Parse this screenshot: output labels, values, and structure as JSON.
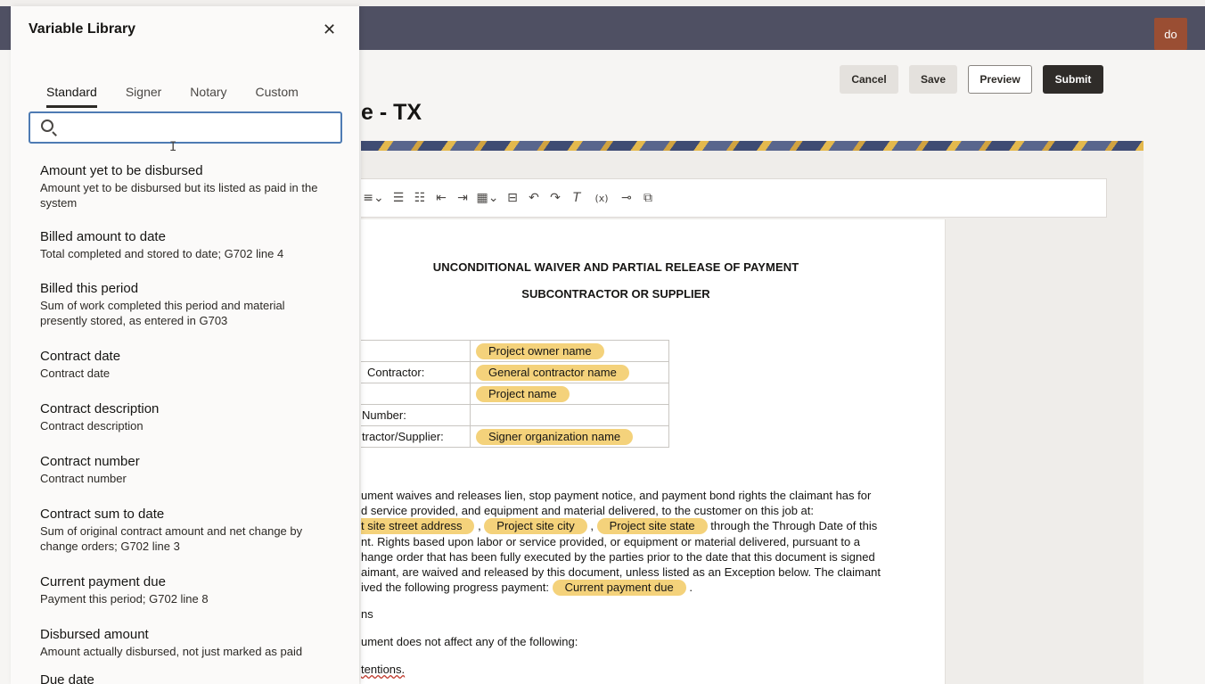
{
  "header": {
    "avatar_initials": "do"
  },
  "actions": {
    "cancel": "Cancel",
    "save": "Save",
    "preview": "Preview",
    "submit": "Submit"
  },
  "page": {
    "title_fragment": "e - TX"
  },
  "toolbar_icons": [
    "align-icon",
    "list-bulleted-icon",
    "list-numbered-icon",
    "outdent-icon",
    "indent-icon",
    "table-icon",
    "page-break-icon",
    "undo-icon",
    "redo-icon",
    "clear-format-icon",
    "variable-icon",
    "signature-icon",
    "copy-icon"
  ],
  "document": {
    "title": "UNCONDITIONAL WAIVER AND PARTIAL RELEASE OF PAYMENT",
    "subtitle": "SUBCONTRACTOR OR SUPPLIER",
    "info_rows": [
      {
        "label": "",
        "value": "Project owner name"
      },
      {
        "label": "Contractor:",
        "value": "General contractor name"
      },
      {
        "label": "",
        "value": "Project name"
      },
      {
        "label": "Number:",
        "value": ""
      },
      {
        "label": "tractor/Supplier:",
        "value": "Signer organization name"
      }
    ],
    "para_line1": "ument waives and releases lien, stop payment notice, and payment bond rights the claimant has for",
    "para_line2": "d service provided, and equipment and material delivered, to the customer on this job at:",
    "para_line3_chip1": "t site street address",
    "para_line3_sep1": " , ",
    "para_line3_chip2": "Project site city",
    "para_line3_sep2": " , ",
    "para_line3_chip3": "Project site state",
    "para_line3_tail": " through the Through Date of this",
    "para_line4": "nt. Rights based upon labor or service provided, or equipment or material delivered, pursuant to a",
    "para_line5": "hange order that has been fully executed by the parties prior to the date that this document is signed",
    "para_line6": "aimant, are waived and released by this document, unless listed as an Exception below. The claimant",
    "para_line7_head": "ived the following progress payment: ",
    "para_line7_chip": "Current payment due",
    "para_line7_tail": " .",
    "exceptions": "ns",
    "not_affect": "ument does not affect any of the following:",
    "intentions": "tentions."
  },
  "panel": {
    "title": "Variable Library",
    "tabs": [
      "Standard",
      "Signer",
      "Notary",
      "Custom"
    ],
    "active_tab": "Standard",
    "search_value": "",
    "variables": [
      {
        "name": "Amount yet to be disbursed",
        "description": "Amount yet to be disbursed but its listed as paid in the system"
      },
      {
        "name": "Billed amount to date",
        "description": "Total completed and stored to date; G702 line 4"
      },
      {
        "name": "Billed this period",
        "description": "Sum of work completed this period and material presently stored, as entered in G703"
      },
      {
        "name": "Contract date",
        "description": "Contract date"
      },
      {
        "name": "Contract description",
        "description": "Contract description"
      },
      {
        "name": "Contract number",
        "description": "Contract number"
      },
      {
        "name": "Contract sum to date",
        "description": "Sum of original contract amount and net change by change orders; G702 line 3"
      },
      {
        "name": "Current payment due",
        "description": "Payment this period; G702 line 8"
      },
      {
        "name": "Disbursed amount",
        "description": "Amount actually disbursed, not just marked as paid"
      },
      {
        "name": "Due date",
        "description": ""
      }
    ]
  }
}
